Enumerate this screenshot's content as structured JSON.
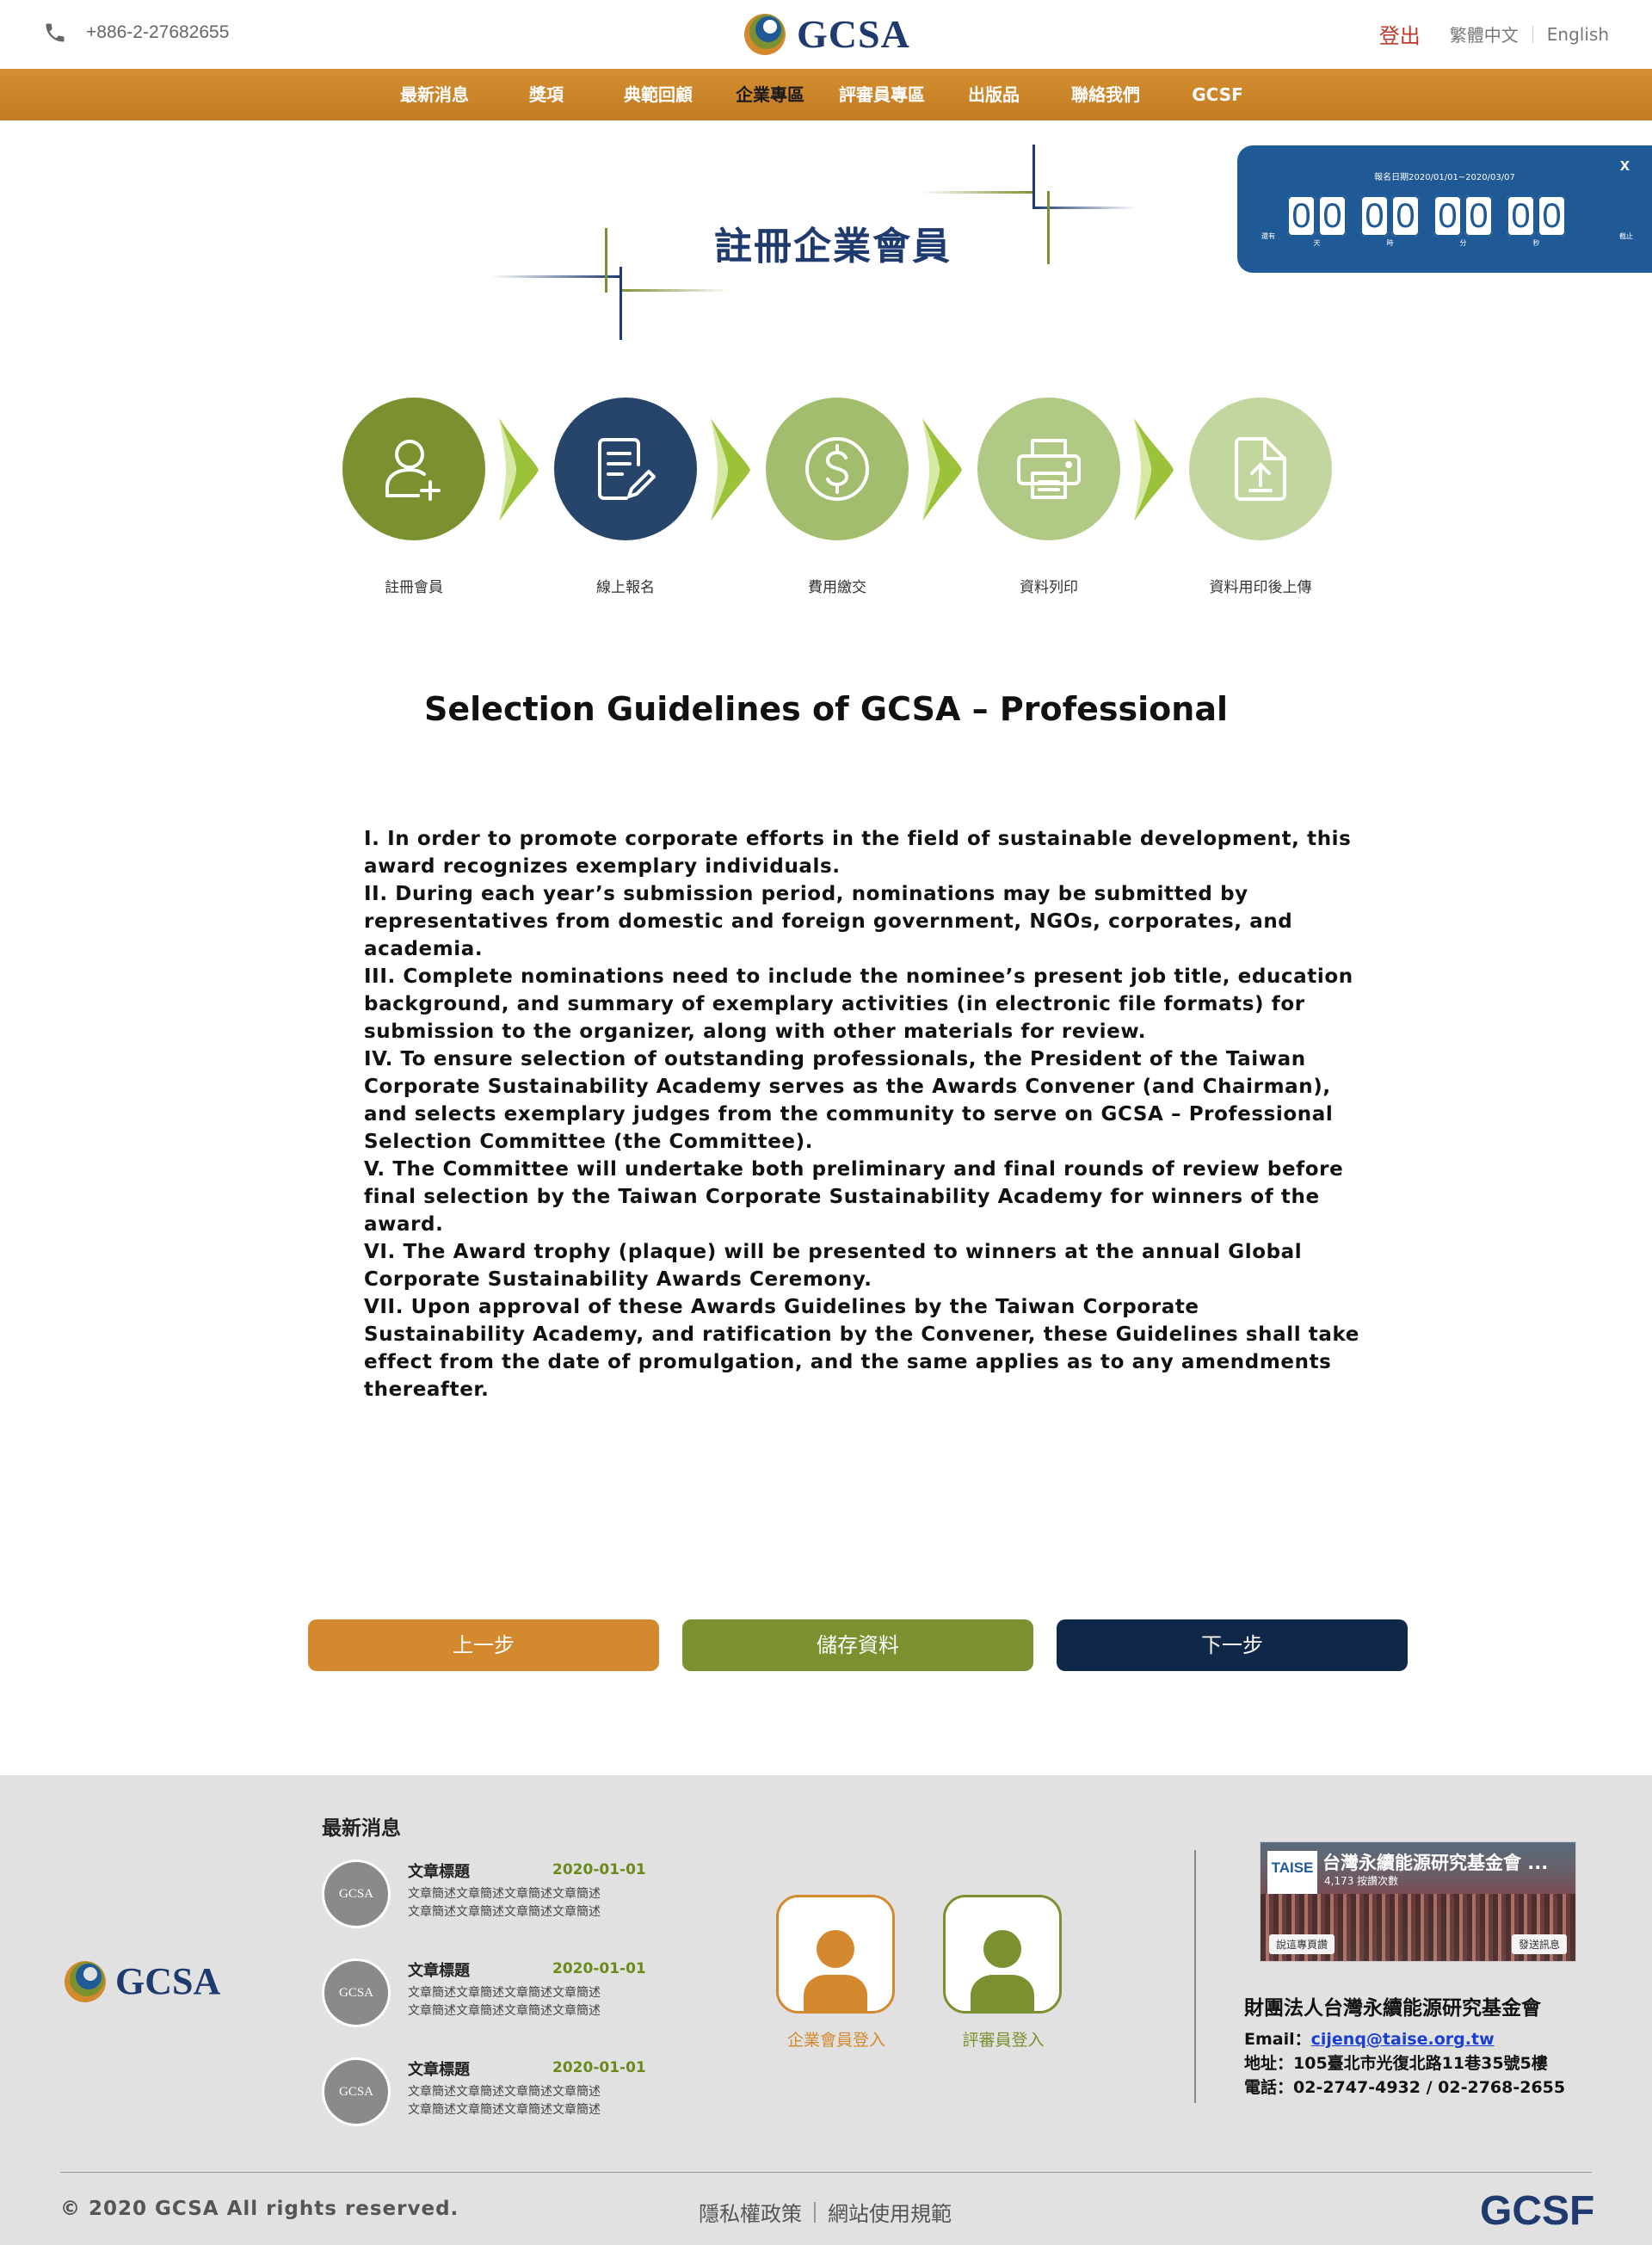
{
  "header": {
    "phone": "+886-2-27682655",
    "logo_text": "GCSA",
    "logout": "登出",
    "lang_zh": "繁體中文",
    "lang_en": "English"
  },
  "nav": {
    "items": [
      {
        "label": "最新消息"
      },
      {
        "label": "獎項"
      },
      {
        "label": "典範回顧"
      },
      {
        "label": "企業專區",
        "active": true
      },
      {
        "label": "評審員專區"
      },
      {
        "label": "出版品"
      },
      {
        "label": "聯絡我們"
      },
      {
        "label": "GCSF"
      }
    ]
  },
  "page_title": "註冊企業會員",
  "countdown": {
    "close": "x",
    "date_range": "報名日期2020/01/01~2020/03/07",
    "left_label": "還有",
    "right_label": "截止",
    "units": [
      {
        "digits": [
          "0",
          "0"
        ],
        "label": "天"
      },
      {
        "digits": [
          "0",
          "0"
        ],
        "label": "時"
      },
      {
        "digits": [
          "0",
          "0"
        ],
        "label": "分"
      },
      {
        "digits": [
          "0",
          "0"
        ],
        "label": "秒"
      }
    ]
  },
  "steps": [
    {
      "label": "註冊會員",
      "icon": "user-add-icon",
      "color": "#7b9130"
    },
    {
      "label": "線上報名",
      "icon": "document-edit-icon",
      "color": "#27446a"
    },
    {
      "label": "費用繳交",
      "icon": "dollar-icon",
      "color": "#a3bd6e"
    },
    {
      "label": "資料列印",
      "icon": "printer-icon",
      "color": "#b0c985"
    },
    {
      "label": "資料用印後上傳",
      "icon": "file-upload-icon",
      "color": "#c3d6a0"
    }
  ],
  "guidelines": {
    "title": "Selection Guidelines of GCSA – Professional",
    "items": [
      "I. In order to promote corporate efforts in the field of sustainable development, this award recognizes exemplary individuals.",
      "II. During each year’s submission period, nominations may be submitted by representatives from domestic and foreign government, NGOs, corporates, and academia.",
      "III. Complete nominations need to include the nominee’s present job title, education background, and summary of exemplary activities (in electronic file formats) for submission to the organizer, along with other materials for review.",
      "IV. To ensure selection of outstanding professionals, the President of the Taiwan Corporate Sustainability Academy serves as the Awards Convener (and Chairman), and selects exemplary judges from the community to serve on GCSA – Professional Selection Committee (the Committee).",
      "V. The Committee will undertake both preliminary and final rounds of review before final selection by the Taiwan Corporate Sustainability Academy for winners of the award.",
      "VI. The Award trophy (plaque) will be presented to winners at the annual Global Corporate Sustainability Awards Ceremony.",
      "VII. Upon approval of these Awards Guidelines by the Taiwan Corporate Sustainability Academy, and ratification by the Convener, these Guidelines shall take effect from the date of promulgation, and the same applies as to any amendments thereafter."
    ]
  },
  "buttons": {
    "prev": "上一步",
    "save": "儲存資料",
    "next": "下一步"
  },
  "footer": {
    "logo_text": "GCSA",
    "news_heading": "最新消息",
    "news": [
      {
        "thumb": "GCSA",
        "title": "文章標題",
        "date": "2020-01-01",
        "desc1": "文章簡述文章簡述文章簡述文章簡述",
        "desc2": "文章簡述文章簡述文章簡述文章簡述"
      },
      {
        "thumb": "GCSA",
        "title": "文章標題",
        "date": "2020-01-01",
        "desc1": "文章簡述文章簡述文章簡述文章簡述",
        "desc2": "文章簡述文章簡述文章簡述文章簡述"
      },
      {
        "thumb": "GCSA",
        "title": "文章標題",
        "date": "2020-01-01",
        "desc1": "文章簡述文章簡述文章簡述文章簡述",
        "desc2": "文章簡述文章簡述文章簡述文章簡述"
      }
    ],
    "corp_login": "企業會員登入",
    "judge_login": "評審員登入",
    "fb": {
      "logo": "TAISE",
      "name": "台灣永續能源研究基金會 ...",
      "count": "4,173 按讚次數",
      "like": "說這專頁讚",
      "message": "發送訊息"
    },
    "org": {
      "name": "財團法人台灣永續能源研究基金會",
      "email_label": "Email：",
      "email": "cijenq@taise.org.tw",
      "address": "地址：105臺北市光復北路11巷35號5樓",
      "tel": "電話：02-2747-4932 / 02-2768-2655"
    },
    "copyright": "© 2020 GCSA All rights reserved.",
    "privacy": "隱私權政策",
    "terms": "網站使用規範",
    "gcsf": "GCSF"
  }
}
